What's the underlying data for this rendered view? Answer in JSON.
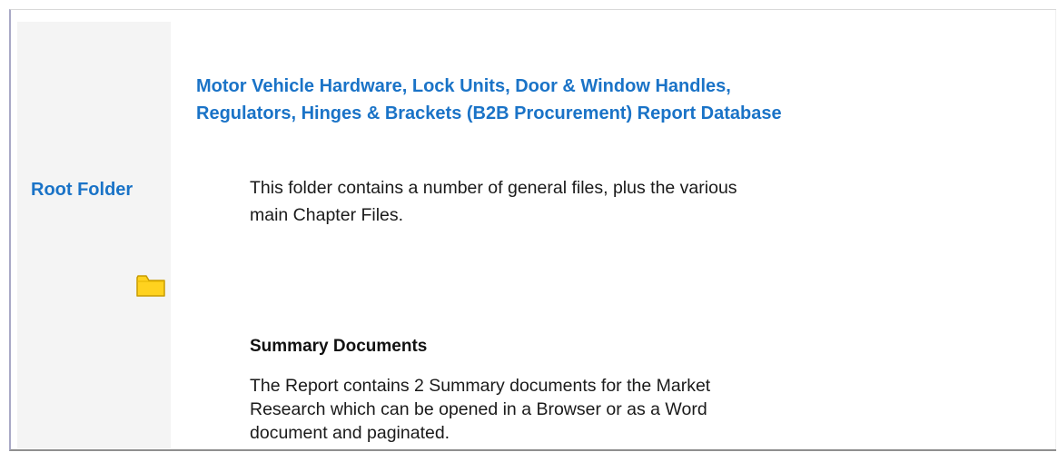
{
  "sidebar": {
    "label": "Root Folder",
    "icon": "folder-icon",
    "icon_color": "#ffd21f"
  },
  "main": {
    "title_line1": "Motor Vehicle Hardware, Lock Units, Door & Window Handles,",
    "title_line2": "Regulators, Hinges & Brackets (B2B Procurement) Report Database",
    "intro_line1": "This folder contains a number of general files, plus the various",
    "intro_line2": "main Chapter Files.",
    "summary": {
      "heading": "Summary Documents",
      "body_line1": "The Report contains 2 Summary documents for the Market",
      "body_line2": "Research which can be opened in a Browser or as a Word",
      "body_line3": "document and paginated."
    }
  },
  "colors": {
    "accent_blue": "#1a73c7",
    "panel_bg": "#f4f4f4",
    "text": "#1a1a1a"
  }
}
